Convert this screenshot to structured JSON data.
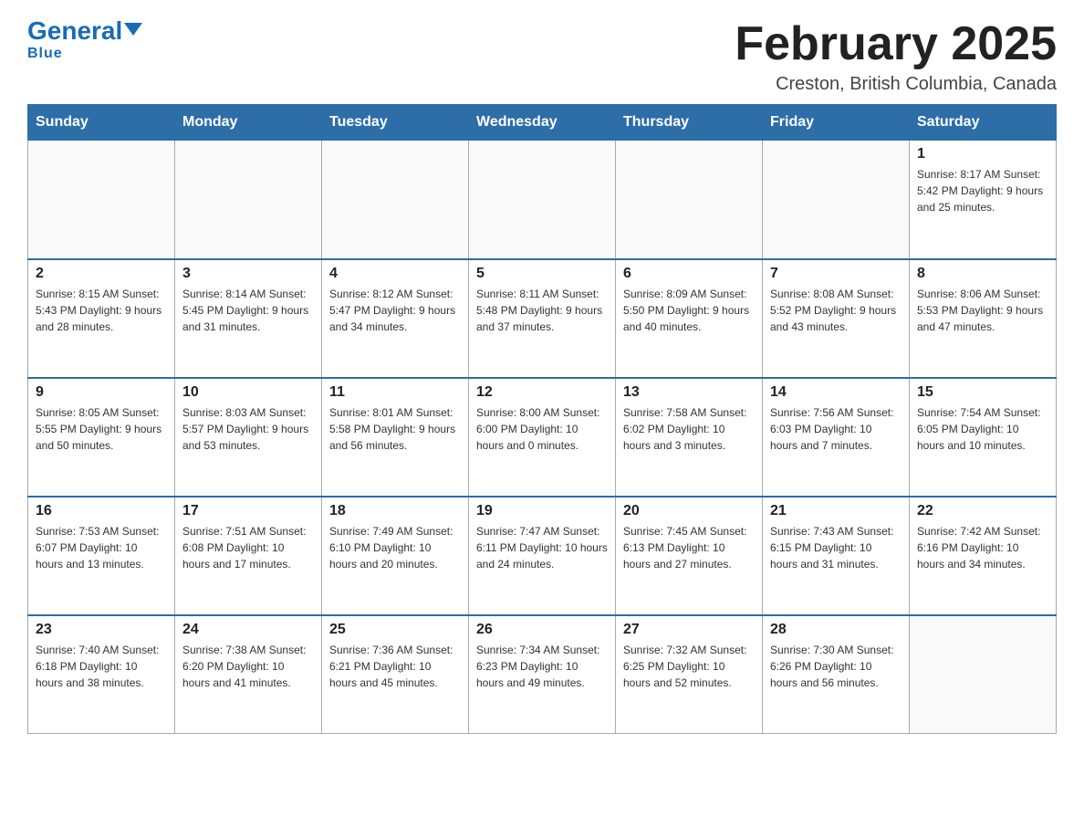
{
  "header": {
    "logo": {
      "general": "General",
      "blue": "Blue"
    },
    "title": "February 2025",
    "subtitle": "Creston, British Columbia, Canada"
  },
  "weekdays": [
    "Sunday",
    "Monday",
    "Tuesday",
    "Wednesday",
    "Thursday",
    "Friday",
    "Saturday"
  ],
  "weeks": [
    [
      {
        "day": "",
        "info": ""
      },
      {
        "day": "",
        "info": ""
      },
      {
        "day": "",
        "info": ""
      },
      {
        "day": "",
        "info": ""
      },
      {
        "day": "",
        "info": ""
      },
      {
        "day": "",
        "info": ""
      },
      {
        "day": "1",
        "info": "Sunrise: 8:17 AM\nSunset: 5:42 PM\nDaylight: 9 hours and 25 minutes."
      }
    ],
    [
      {
        "day": "2",
        "info": "Sunrise: 8:15 AM\nSunset: 5:43 PM\nDaylight: 9 hours and 28 minutes."
      },
      {
        "day": "3",
        "info": "Sunrise: 8:14 AM\nSunset: 5:45 PM\nDaylight: 9 hours and 31 minutes."
      },
      {
        "day": "4",
        "info": "Sunrise: 8:12 AM\nSunset: 5:47 PM\nDaylight: 9 hours and 34 minutes."
      },
      {
        "day": "5",
        "info": "Sunrise: 8:11 AM\nSunset: 5:48 PM\nDaylight: 9 hours and 37 minutes."
      },
      {
        "day": "6",
        "info": "Sunrise: 8:09 AM\nSunset: 5:50 PM\nDaylight: 9 hours and 40 minutes."
      },
      {
        "day": "7",
        "info": "Sunrise: 8:08 AM\nSunset: 5:52 PM\nDaylight: 9 hours and 43 minutes."
      },
      {
        "day": "8",
        "info": "Sunrise: 8:06 AM\nSunset: 5:53 PM\nDaylight: 9 hours and 47 minutes."
      }
    ],
    [
      {
        "day": "9",
        "info": "Sunrise: 8:05 AM\nSunset: 5:55 PM\nDaylight: 9 hours and 50 minutes."
      },
      {
        "day": "10",
        "info": "Sunrise: 8:03 AM\nSunset: 5:57 PM\nDaylight: 9 hours and 53 minutes."
      },
      {
        "day": "11",
        "info": "Sunrise: 8:01 AM\nSunset: 5:58 PM\nDaylight: 9 hours and 56 minutes."
      },
      {
        "day": "12",
        "info": "Sunrise: 8:00 AM\nSunset: 6:00 PM\nDaylight: 10 hours and 0 minutes."
      },
      {
        "day": "13",
        "info": "Sunrise: 7:58 AM\nSunset: 6:02 PM\nDaylight: 10 hours and 3 minutes."
      },
      {
        "day": "14",
        "info": "Sunrise: 7:56 AM\nSunset: 6:03 PM\nDaylight: 10 hours and 7 minutes."
      },
      {
        "day": "15",
        "info": "Sunrise: 7:54 AM\nSunset: 6:05 PM\nDaylight: 10 hours and 10 minutes."
      }
    ],
    [
      {
        "day": "16",
        "info": "Sunrise: 7:53 AM\nSunset: 6:07 PM\nDaylight: 10 hours and 13 minutes."
      },
      {
        "day": "17",
        "info": "Sunrise: 7:51 AM\nSunset: 6:08 PM\nDaylight: 10 hours and 17 minutes."
      },
      {
        "day": "18",
        "info": "Sunrise: 7:49 AM\nSunset: 6:10 PM\nDaylight: 10 hours and 20 minutes."
      },
      {
        "day": "19",
        "info": "Sunrise: 7:47 AM\nSunset: 6:11 PM\nDaylight: 10 hours and 24 minutes."
      },
      {
        "day": "20",
        "info": "Sunrise: 7:45 AM\nSunset: 6:13 PM\nDaylight: 10 hours and 27 minutes."
      },
      {
        "day": "21",
        "info": "Sunrise: 7:43 AM\nSunset: 6:15 PM\nDaylight: 10 hours and 31 minutes."
      },
      {
        "day": "22",
        "info": "Sunrise: 7:42 AM\nSunset: 6:16 PM\nDaylight: 10 hours and 34 minutes."
      }
    ],
    [
      {
        "day": "23",
        "info": "Sunrise: 7:40 AM\nSunset: 6:18 PM\nDaylight: 10 hours and 38 minutes."
      },
      {
        "day": "24",
        "info": "Sunrise: 7:38 AM\nSunset: 6:20 PM\nDaylight: 10 hours and 41 minutes."
      },
      {
        "day": "25",
        "info": "Sunrise: 7:36 AM\nSunset: 6:21 PM\nDaylight: 10 hours and 45 minutes."
      },
      {
        "day": "26",
        "info": "Sunrise: 7:34 AM\nSunset: 6:23 PM\nDaylight: 10 hours and 49 minutes."
      },
      {
        "day": "27",
        "info": "Sunrise: 7:32 AM\nSunset: 6:25 PM\nDaylight: 10 hours and 52 minutes."
      },
      {
        "day": "28",
        "info": "Sunrise: 7:30 AM\nSunset: 6:26 PM\nDaylight: 10 hours and 56 minutes."
      },
      {
        "day": "",
        "info": ""
      }
    ]
  ]
}
